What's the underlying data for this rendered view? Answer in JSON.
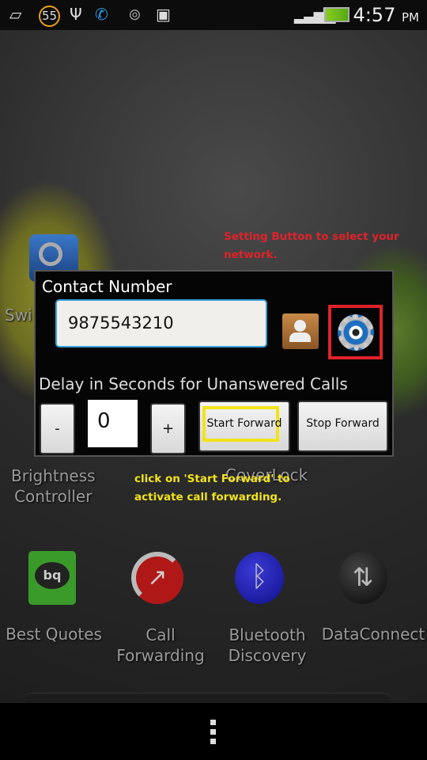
{
  "status_bar": {
    "notification_count": "55",
    "time": "4:57",
    "ampm": "PM",
    "icons": [
      "battery-leaf-icon",
      "usb-icon",
      "call-forward-icon",
      "lock-icon",
      "android-debug-icon",
      "signal-icon",
      "battery-charging-icon"
    ]
  },
  "homescreen": {
    "partial_label_swi": "Swi",
    "brightness_label": [
      "Brightness",
      "Controller"
    ],
    "coverlock_label": "CoverLock",
    "apps": [
      {
        "label": [
          "Best Quotes"
        ],
        "icon": "best-quotes-icon"
      },
      {
        "label": [
          "Call",
          "Forwarding"
        ],
        "icon": "call-forwarding-icon"
      },
      {
        "label": [
          "Bluetooth",
          "Discovery"
        ],
        "icon": "bluetooth-icon"
      },
      {
        "label": [
          "DataConnect"
        ],
        "icon": "data-connect-icon"
      }
    ]
  },
  "annotations": {
    "settings_note": [
      "Setting Button to select your",
      "network."
    ],
    "start_note": [
      "click on 'Start Forward' to",
      "activate call forwarding."
    ],
    "settings_highlight_color": "#e0222a",
    "start_highlight_color": "#f2e31a"
  },
  "dialog": {
    "contact_label": "Contact Number",
    "contact_value": "9875543210",
    "delay_label": "Delay in Seconds for Unanswered Calls",
    "minus_label": "-",
    "delay_value": "0",
    "plus_label": "+",
    "start_label": "Start Forward",
    "stop_label": "Stop Forward"
  }
}
